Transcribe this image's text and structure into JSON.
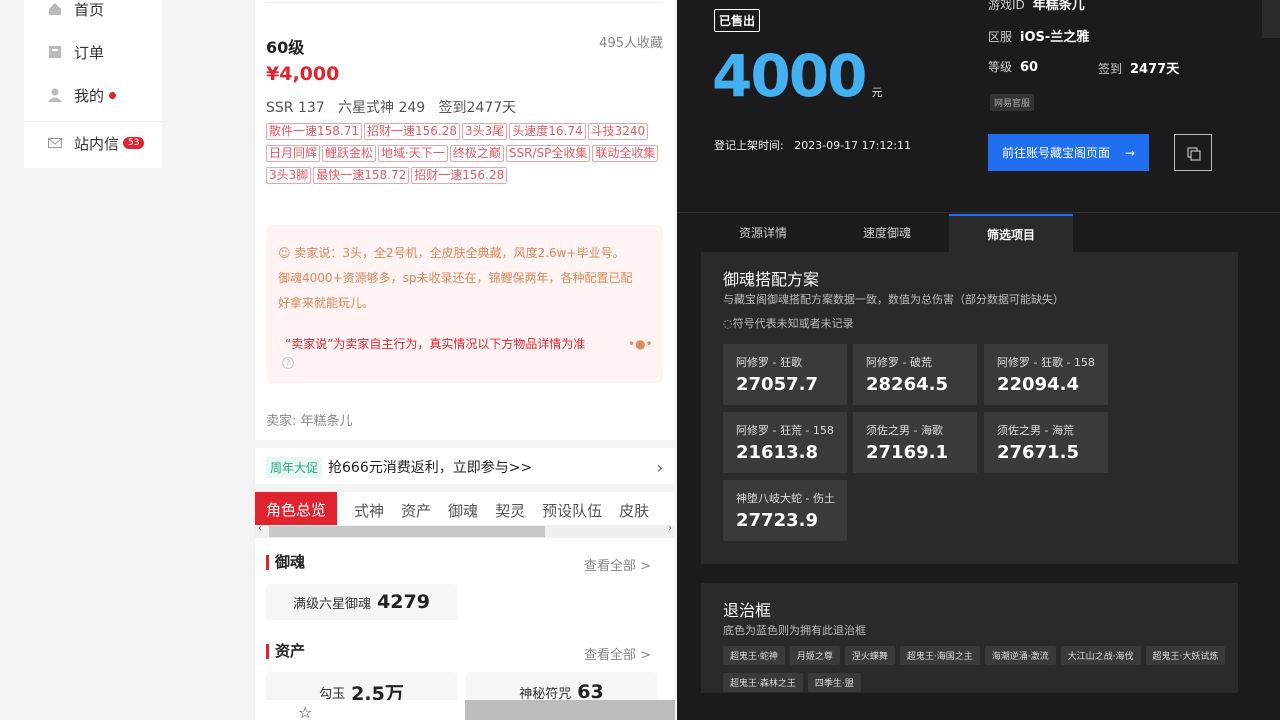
{
  "nav": {
    "items": [
      {
        "label": "首页",
        "icon": "home-icon"
      },
      {
        "label": "订单",
        "icon": "order-icon"
      },
      {
        "label": "我的",
        "icon": "user-icon"
      },
      {
        "label": "站内信",
        "icon": "mail-icon",
        "badge": "53"
      }
    ]
  },
  "listing": {
    "level": "60级",
    "favorites": "495人收藏",
    "price": "¥4,000",
    "stats": "SSR 137   六星式神 249   签到2477天",
    "tags": [
      "散件一速158.71",
      "招财一速156.28",
      "3头3尾",
      "头速度16.74",
      "斗技3240",
      "日月同辉",
      "鲤跃金松",
      "地域·天下一",
      "终极之巅",
      "SSR/SP全收集",
      "联动全收集",
      "3头3脚",
      "最快一速158.72",
      "招财一速156.28"
    ],
    "seller_says_line1": "卖家说：3头，全2号机，全皮肤全典藏，风度2.6w+毕业号。",
    "seller_says_line2": "御魂4000+资源够多，sp未收录还在，锦鲤保两年，各种配置已配",
    "seller_says_line3": "好拿来就能玩儿。",
    "disclaimer": "“卖家说”为卖家自主行为，真实情况以下方物品详情为准",
    "seller": "卖家: 年糕条儿"
  },
  "promo": {
    "badge": "周年大促",
    "text": "抢666元消费返利，立即参与>>"
  },
  "tabs": [
    "角色总览",
    "式神",
    "资产",
    "御魂",
    "契灵",
    "预设队伍",
    "皮肤"
  ],
  "sections": {
    "yuhun": {
      "title": "御魂",
      "see_all": "查看全部 >",
      "card_label": "满级六星御魂",
      "card_value": "4279"
    },
    "assets": {
      "title": "资产",
      "see_all": "查看全部 >",
      "card1_label": "勾玉",
      "card1_value": "2.5万",
      "card2_label": "神秘符咒",
      "card2_value": "63"
    }
  },
  "detail": {
    "sold_badge": "已售出",
    "price": "4000",
    "price_unit": "元",
    "game_id_label": "游戏ID",
    "game_id": "年糕条儿",
    "server_label": "区服",
    "server": "iOS-兰之雅",
    "level_label": "等级",
    "level": "60",
    "signin_label": "签到",
    "signin": "2477天",
    "official_badge": "网易官服",
    "listed_time": "登记上架时间:   2023-09-17 17:12:11",
    "goto_button": "前往账号藏宝阁页面",
    "tabs": [
      "资源详情",
      "速度御魂",
      "筛选项目"
    ]
  },
  "yuhun_plan": {
    "title": "御魂搭配方案",
    "subtitle": "与藏宝阁御魂搭配方案数据一致，数值为总伤害（部分数据可能缺失）",
    "note": "◌符号代表未知或者未记录",
    "cards": [
      {
        "name": "阿修罗 - 狂歌",
        "value": "27057.7"
      },
      {
        "name": "阿修罗 - 破荒",
        "value": "28264.5"
      },
      {
        "name": "阿修罗 - 狂歌 - 158",
        "value": "22094.4"
      },
      {
        "name": "阿修罗 - 狂荒 - 158",
        "value": "21613.8"
      },
      {
        "name": "须佐之男 - 海歌",
        "value": "27169.1"
      },
      {
        "name": "须佐之男 - 海荒",
        "value": "27671.5"
      },
      {
        "name": "神堕八岐大蛇 - 伤土",
        "value": "27723.9"
      }
    ]
  },
  "frames": {
    "title": "退治框",
    "subtitle": "底色为蓝色则为拥有此退治框",
    "tags": [
      "超鬼王·蛇神",
      "月姬之尊",
      "涅火蝶舞",
      "超鬼王·海国之主",
      "海潮逆涌·激流",
      "大江山之战·海伐",
      "超鬼王·大妖试炼",
      "超鬼王·森林之王",
      "四季生·盟"
    ]
  },
  "colors": {
    "accent_red": "#e0242f",
    "accent_blue": "#1f6ff0",
    "price_blue": "#43b0f1"
  }
}
